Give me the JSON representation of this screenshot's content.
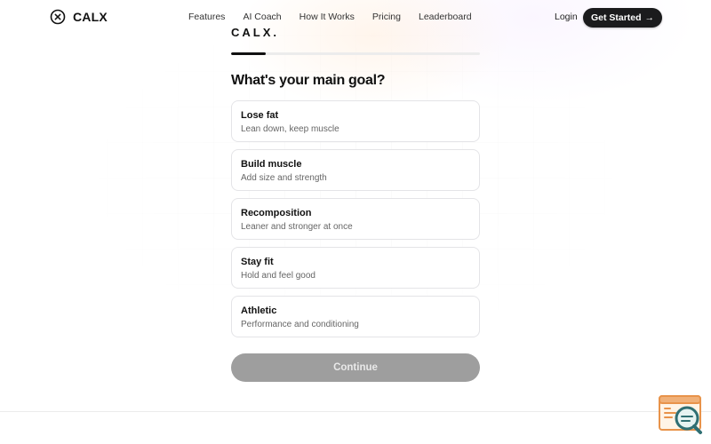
{
  "nav": {
    "brand": "CALX",
    "links": [
      "Features",
      "AI Coach",
      "How It Works",
      "Pricing",
      "Leaderboard"
    ],
    "login": "Login",
    "cta": "Get Started",
    "cta_arrow": "→"
  },
  "quiz": {
    "logo": "CALX.",
    "progress_fraction": 0.14,
    "question": "What's your main goal?",
    "options": [
      {
        "title": "Lose fat",
        "desc": "Lean down, keep muscle"
      },
      {
        "title": "Build muscle",
        "desc": "Add size and strength"
      },
      {
        "title": "Recomposition",
        "desc": "Leaner and stronger at once"
      },
      {
        "title": "Stay fit",
        "desc": "Hold and feel good"
      },
      {
        "title": "Athletic",
        "desc": "Performance and conditioning"
      }
    ],
    "continue_label": "Continue"
  },
  "colors": {
    "primary": "#1b1b1d",
    "disabled_button": "#9e9e9e",
    "helper_accent": "#e8934a",
    "helper_teal": "#2f6f73"
  },
  "icons": {
    "brand": "calx-logo-icon",
    "helper": "chat-search-helper-icon"
  }
}
